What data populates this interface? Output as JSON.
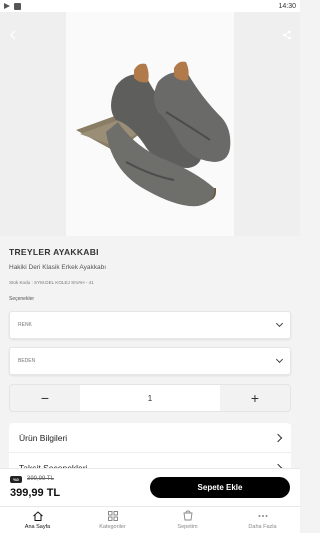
{
  "status_bar": {
    "time": "14:30"
  },
  "product": {
    "brand": "TREYLER AYAKKABI",
    "name": "Hakiki Deri Klasik Erkek Ayakkabı",
    "sku": "Stok Kodu : SYM.DEL KOLEJ SIVAH - 41",
    "options_label": "Seçenekler"
  },
  "options": {
    "color_placeholder": "RENK",
    "size_placeholder": "BEDEN"
  },
  "quantity": {
    "minus": "−",
    "value": "1",
    "plus": "+"
  },
  "accordion": {
    "items": [
      "Ürün Bilgileri",
      "Taksit Seçenekleri"
    ]
  },
  "price": {
    "discount_badge": "%0",
    "old": "399,99 TL",
    "current": "399,99 TL"
  },
  "cart_button": "Sepete Ekle",
  "tabs": [
    {
      "label": "Ana Sayfa",
      "icon": "home-icon",
      "active": true
    },
    {
      "label": "Kategoriler",
      "icon": "grid-icon",
      "active": false
    },
    {
      "label": "Sepetim",
      "icon": "cart-icon",
      "active": false
    },
    {
      "label": "Daha Fazla",
      "icon": "more-icon",
      "active": false
    }
  ],
  "colors": {
    "accent": "#000000",
    "background": "#f3f3f3"
  }
}
